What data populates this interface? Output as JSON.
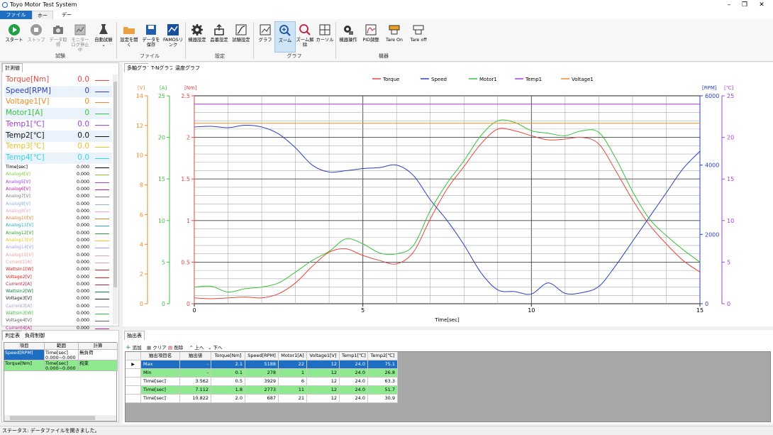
{
  "window": {
    "title": "Toyo Motor Test System"
  },
  "menu_tabs": [
    "ファイル",
    "ホーム",
    "データ"
  ],
  "ribbon": {
    "buttons": [
      {
        "label": "スタート",
        "icon": "play-icon"
      },
      {
        "label": "ストップ",
        "icon": "stop-icon"
      },
      {
        "label": "データ取得",
        "icon": "camera-icon"
      },
      {
        "label": "モニターログ停止中",
        "icon": "monitor-log-icon"
      },
      {
        "label": "自動試験",
        "icon": "flask-icon"
      },
      {
        "label": "設定を開く",
        "icon": "folder-icon"
      },
      {
        "label": "データを保存",
        "icon": "save-icon"
      },
      {
        "label": "FAMOSリンク",
        "icon": "famos-icon"
      },
      {
        "label": "機器設定",
        "icon": "gear-icon"
      },
      {
        "label": "品番設定",
        "icon": "product-icon"
      },
      {
        "label": "試験設定",
        "icon": "test-setting-icon"
      },
      {
        "label": "グラフ",
        "icon": "graph-icon"
      },
      {
        "label": "ズーム",
        "icon": "zoom-in-icon"
      },
      {
        "label": "ズーム解除",
        "icon": "zoom-reset-icon"
      },
      {
        "label": "カーソル",
        "icon": "cursor-icon"
      },
      {
        "label": "機器操作",
        "icon": "device-operate-icon"
      },
      {
        "label": "PID調整",
        "icon": "pid-icon"
      },
      {
        "label": "Tare On",
        "icon": "tare-on-icon"
      },
      {
        "label": "Tare off",
        "icon": "tare-off-icon"
      }
    ],
    "groups": [
      "試験",
      "ファイル",
      "設定",
      "グラフ",
      "機器"
    ],
    "dropdown_glyph": "⌄"
  },
  "left_panel": {
    "tab": "計測値",
    "channels_big": [
      {
        "name": "Torque[Nm]",
        "value": "0.0",
        "color": "#e8463c"
      },
      {
        "name": "Speed[RPM]",
        "value": "0",
        "color": "#2a3fc0"
      },
      {
        "name": "Voltage1[V]",
        "value": "0",
        "color": "#f08a24"
      },
      {
        "name": "Motor1[A]",
        "value": "0",
        "color": "#3cc23c"
      },
      {
        "name": "Temp1[℃]",
        "value": "0.0",
        "color": "#a040e0"
      },
      {
        "name": "Temp2[℃]",
        "value": "0.0",
        "color": "#111111"
      },
      {
        "name": "Temp3[℃]",
        "value": "0.0",
        "color": "#f0c020"
      },
      {
        "name": "Temp4[℃]",
        "value": "0.0",
        "color": "#30d8e0"
      }
    ],
    "channels_small": [
      {
        "name": "Time[sec]",
        "value": "0.000",
        "color": "#000000"
      },
      {
        "name": "Analog4[V]",
        "value": "0.000",
        "color": "#7ad030"
      },
      {
        "name": "Analog5[V]",
        "value": "0.000",
        "color": "#a040e0"
      },
      {
        "name": "Analog6[V]",
        "value": "0.000",
        "color": "#c020a0"
      },
      {
        "name": "Analog7[V]",
        "value": "0.000",
        "color": "#808080"
      },
      {
        "name": "Analog8[V]",
        "value": "0.000",
        "color": "#90b0e0"
      },
      {
        "name": "Analog9[V]",
        "value": "0.000",
        "color": "#f0a0c0"
      },
      {
        "name": "Analog10[V]",
        "value": "0.000",
        "color": "#e08030"
      },
      {
        "name": "Analog11[V]",
        "value": "0.000",
        "color": "#20b0c0"
      },
      {
        "name": "Analog12[V]",
        "value": "0.000",
        "color": "#30a030"
      },
      {
        "name": "Analog13[V]",
        "value": "0.000",
        "color": "#f0c020"
      },
      {
        "name": "Analog14[V]",
        "value": "0.000",
        "color": "#a0a0f0"
      },
      {
        "name": "Analog15[V]",
        "value": "0.000",
        "color": "#f0a0a0"
      },
      {
        "name": "Current1[A]",
        "value": "0.000",
        "color": "#f0a0a0"
      },
      {
        "name": "WattsIn1[W]",
        "value": "0.000",
        "color": "#e02020"
      },
      {
        "name": "Voltage2[V]",
        "value": "0.000",
        "color": "#e02020"
      },
      {
        "name": "Current2[A]",
        "value": "0.000",
        "color": "#c02040"
      },
      {
        "name": "WattsIn2[W]",
        "value": "0.000",
        "color": "#108040"
      },
      {
        "name": "Voltage3[V]",
        "value": "0.000",
        "color": "#202020"
      },
      {
        "name": "Current3[A]",
        "value": "0.000",
        "color": "#a0a0c0"
      },
      {
        "name": "WattsIn3[W]",
        "value": "0.000",
        "color": "#40c040"
      },
      {
        "name": "Voltage4[V]",
        "value": "0.000",
        "color": "#606060"
      },
      {
        "name": "Current4[A]",
        "value": "0.000",
        "color": "#c02080"
      }
    ]
  },
  "graph_tabs": [
    "多軸グラフ",
    "T-Nグラフ",
    "温度グラフ"
  ],
  "chart_data": {
    "type": "line",
    "xlabel": "Time[sec]",
    "xlim": [
      0,
      15
    ],
    "x_ticks": [
      0,
      5,
      10,
      15
    ],
    "legend": [
      "Torque",
      "Speed",
      "Motor1",
      "Temp1",
      "Voltage1"
    ],
    "legend_position": "top-center",
    "grid": true,
    "axes": [
      {
        "unit": "[V]",
        "side": "left",
        "ylim": [
          0,
          14
        ],
        "ticks": [
          0,
          2,
          4,
          6,
          8,
          10,
          12,
          14
        ],
        "color": "#f08a24"
      },
      {
        "unit": "[A]",
        "side": "left",
        "ylim": [
          0,
          25
        ],
        "ticks": [
          0,
          5,
          10,
          15,
          20,
          25
        ],
        "color": "#3cc23c"
      },
      {
        "unit": "[Nm]",
        "side": "left",
        "ylim": [
          0,
          2.5
        ],
        "ticks": [
          0,
          0.5,
          1,
          1.5,
          2,
          2.5
        ],
        "color": "#e8463c"
      },
      {
        "unit": "[RPM]",
        "side": "right",
        "ylim": [
          0,
          6000
        ],
        "ticks": [
          0,
          2000,
          4000,
          6000
        ],
        "color": "#2a3fc0"
      },
      {
        "unit": "[℃]",
        "side": "right",
        "ylim": [
          0,
          25
        ],
        "ticks": [
          0,
          5,
          10,
          15,
          20,
          25
        ],
        "color": "#a040e0"
      }
    ],
    "series": [
      {
        "name": "Torque",
        "axis": 2,
        "color": "#e8463c",
        "x": [
          0,
          0.5,
          1,
          1.5,
          2,
          2.5,
          3,
          3.5,
          4,
          4.5,
          5,
          5.5,
          6,
          6.5,
          7,
          7.5,
          8,
          8.5,
          9,
          9.5,
          10,
          10.5,
          11,
          11.5,
          12,
          12.5,
          13,
          13.5,
          14,
          14.5,
          15
        ],
        "y": [
          0.07,
          0.06,
          0.07,
          0.08,
          0.07,
          0.12,
          0.25,
          0.45,
          0.62,
          0.66,
          0.58,
          0.52,
          0.48,
          0.62,
          1.02,
          1.38,
          1.65,
          1.92,
          2.1,
          2.08,
          2.02,
          1.97,
          1.98,
          2.0,
          1.92,
          1.6,
          1.25,
          0.95,
          0.72,
          0.52,
          0.38
        ]
      },
      {
        "name": "Speed",
        "axis": 3,
        "color": "#2a3fc0",
        "x": [
          0,
          0.5,
          1,
          1.5,
          2,
          2.5,
          3,
          3.5,
          4,
          4.5,
          5,
          5.5,
          6,
          6.5,
          7,
          7.5,
          8,
          8.5,
          9,
          9.5,
          10,
          10.5,
          11,
          11.5,
          12,
          12.5,
          13,
          13.5,
          14,
          14.5,
          15
        ],
        "y": [
          5100,
          5120,
          5080,
          5150,
          5100,
          4900,
          4500,
          4000,
          3800,
          3840,
          3900,
          3930,
          4000,
          3700,
          3000,
          2400,
          1700,
          900,
          400,
          350,
          280,
          600,
          300,
          320,
          500,
          1100,
          1800,
          2500,
          3200,
          3900,
          4400
        ]
      },
      {
        "name": "Motor1",
        "axis": 1,
        "color": "#3cc23c",
        "x": [
          0,
          0.5,
          1,
          1.5,
          2,
          2.5,
          3,
          3.5,
          4,
          4.5,
          5,
          5.5,
          6,
          6.5,
          7,
          7.5,
          8,
          8.5,
          9,
          9.5,
          10,
          10.5,
          11,
          11.5,
          12,
          12.5,
          13,
          13.5,
          14,
          14.5,
          15
        ],
        "y": [
          2,
          2.1,
          1.4,
          1.8,
          2,
          2.5,
          3.8,
          5.2,
          6.3,
          7.8,
          7.2,
          6.1,
          6,
          7,
          11.2,
          14.5,
          17.2,
          20.2,
          22,
          21.8,
          20.8,
          20.5,
          20.2,
          20.8,
          20.6,
          17.5,
          13.5,
          10.2,
          8.2,
          6.5,
          5
        ]
      },
      {
        "name": "Temp1",
        "axis": 4,
        "color": "#a040e0",
        "x": [
          0,
          15
        ],
        "y": [
          24,
          24
        ]
      },
      {
        "name": "Voltage1",
        "axis": 0,
        "color": "#f08a24",
        "x": [
          0,
          15
        ],
        "y": [
          12.15,
          12.15
        ]
      }
    ]
  },
  "judge_panel": {
    "tabs": [
      "判定表",
      "負荷制御"
    ],
    "headers": [
      "項目",
      "範囲",
      "計算"
    ],
    "rows": [
      {
        "item": "Speed[RPM]",
        "range": "Time[sec] 0.000~0.000",
        "calc": "無負荷"
      },
      {
        "item": "Torque[Nm]",
        "range": "Time[sec] 0.000~0.000",
        "calc": "拘束"
      }
    ]
  },
  "extract_panel": {
    "tab": "抽出表",
    "toolbar": [
      "追加",
      "クリア",
      "削除",
      "上へ",
      "下へ"
    ],
    "headers": [
      "抽出項目名",
      "抽出値",
      "Torque[Nm]",
      "Speed[RPM]",
      "Motor1[A]",
      "Voltage1[V]",
      "Temp1[℃]",
      "Temp2[℃]"
    ],
    "rows": [
      [
        "Max",
        "-",
        "2.1",
        "5188",
        "22",
        "12",
        "24.0",
        "75.1"
      ],
      [
        "Min",
        "-",
        "0.1",
        "278",
        "1",
        "12",
        "24.0",
        "26.8"
      ],
      [
        "Time[sec]",
        "3.562",
        "0.5",
        "3929",
        "6",
        "12",
        "24.0",
        "63.3"
      ],
      [
        "Time[sec]",
        "7.112",
        "1.8",
        "2773",
        "11",
        "12",
        "24.0",
        "51.7"
      ],
      [
        "Time[sec]",
        "10.822",
        "2.0",
        "687",
        "21",
        "12",
        "24.0",
        "30.9"
      ]
    ]
  },
  "status": {
    "text": "ステータス: データファイルを開きました。"
  }
}
